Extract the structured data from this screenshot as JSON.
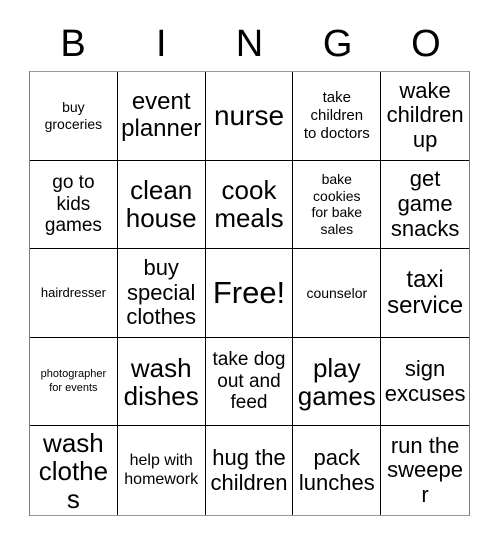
{
  "card": {
    "header_letters": [
      "B",
      "I",
      "N",
      "G",
      "O"
    ],
    "free_space_label": "Free!",
    "colors": {
      "background": "#ffffff",
      "text": "#000000",
      "grid_line": "#000000",
      "outer_border": "#7a7a7a"
    },
    "grid": {
      "columns": 5,
      "rows": 5,
      "cells": [
        {
          "text": "buy\ngroceries",
          "size": "sm"
        },
        {
          "text": "event\nplanner",
          "size": "2xl"
        },
        {
          "text": "nurse",
          "size": "4xl"
        },
        {
          "text": "take\nchildren\nto doctors",
          "size": "smd"
        },
        {
          "text": "wake\nchildren\nup",
          "size": "xl"
        },
        {
          "text": "go to\nkids\ngames",
          "size": "lg"
        },
        {
          "text": "clean\nhouse",
          "size": "3xl"
        },
        {
          "text": "cook\nmeals",
          "size": "3xl"
        },
        {
          "text": "bake\ncookies\nfor bake\nsales",
          "size": "sm"
        },
        {
          "text": "get\ngame\nsnacks",
          "size": "xl"
        },
        {
          "text": "hairdresser",
          "size": "xs"
        },
        {
          "text": "buy\nspecial\nclothes",
          "size": "xl"
        },
        {
          "text": "Free!",
          "size": "5xl"
        },
        {
          "text": "counselor",
          "size": "sm"
        },
        {
          "text": "taxi\nservice",
          "size": "2xl"
        },
        {
          "text": "photographer\nfor events",
          "size": "xxs"
        },
        {
          "text": "wash\ndishes",
          "size": "3xl"
        },
        {
          "text": "take dog\nout and\nfeed",
          "size": "lg"
        },
        {
          "text": "play\ngames",
          "size": "3xl"
        },
        {
          "text": "sign\nexcuses",
          "size": "xl"
        },
        {
          "text": "wash\nclothes",
          "size": "3xl"
        },
        {
          "text": "help with\nhomework",
          "size": "md"
        },
        {
          "text": "hug the\nchildren",
          "size": "xl"
        },
        {
          "text": "pack\nlunches",
          "size": "xl"
        },
        {
          "text": "run the\nsweeper",
          "size": "xl"
        }
      ]
    }
  }
}
